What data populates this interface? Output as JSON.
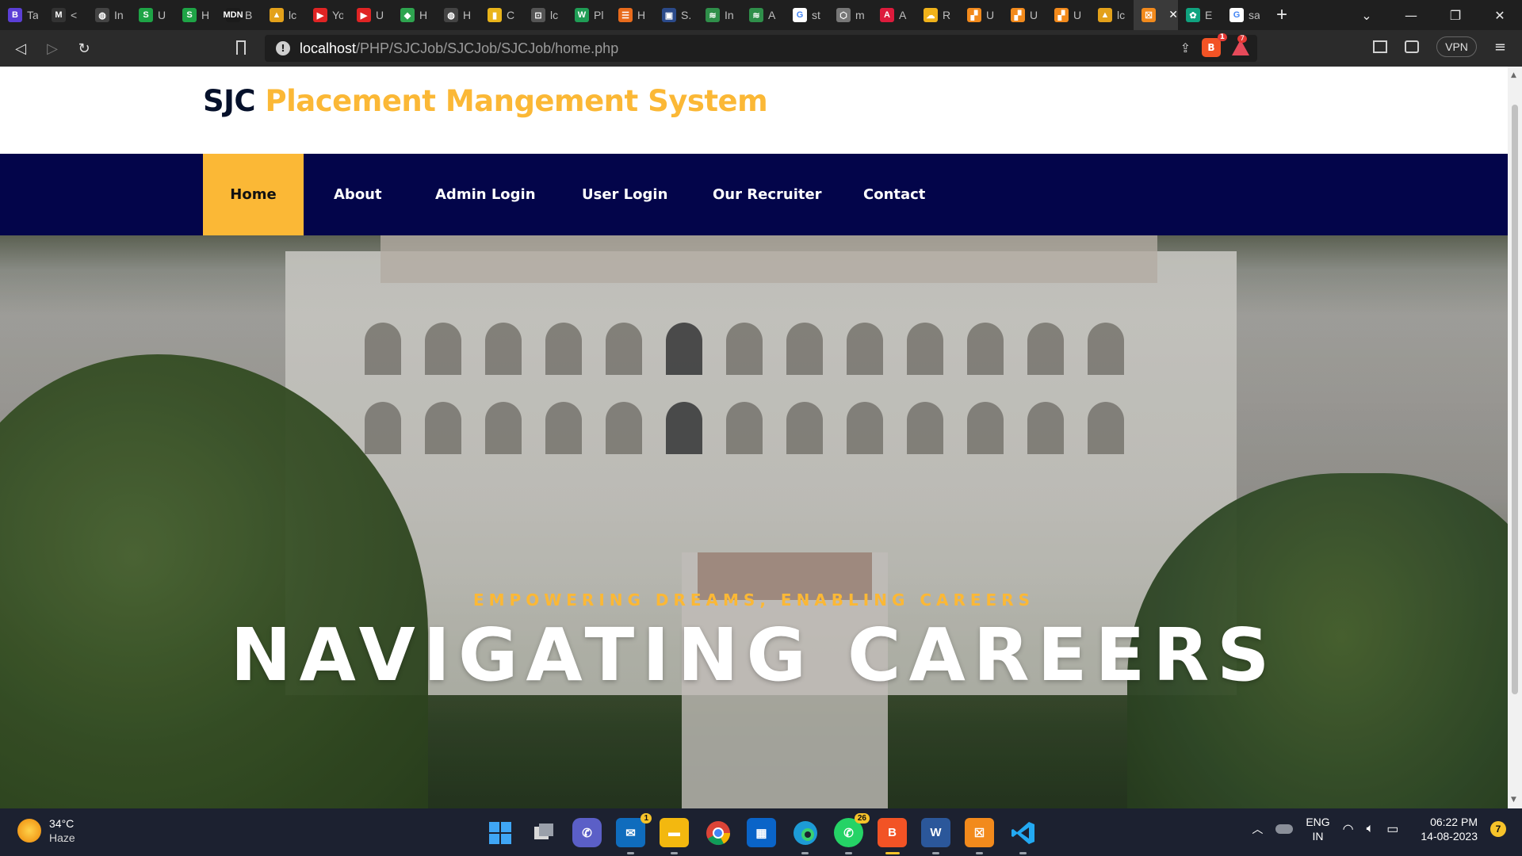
{
  "browser": {
    "tabs": [
      {
        "icon": "B",
        "title": "Ta",
        "color": "#5b3fd6"
      },
      {
        "icon": "M",
        "title": "<",
        "color": "#333333"
      },
      {
        "icon": "◍",
        "title": "In",
        "color": "#444444"
      },
      {
        "icon": "S",
        "title": "U",
        "color": "#1ea446"
      },
      {
        "icon": "S",
        "title": "H",
        "color": "#1ea446"
      },
      {
        "icon": "MDN",
        "title": "B",
        "color": "#1b1b1b"
      },
      {
        "icon": "▲",
        "title": "lc",
        "color": "#e3a11a"
      },
      {
        "icon": "▶",
        "title": "Yo",
        "color": "#e02424"
      },
      {
        "icon": "▶",
        "title": "U",
        "color": "#e02424"
      },
      {
        "icon": "◆",
        "title": "H",
        "color": "#2ea44f"
      },
      {
        "icon": "◍",
        "title": "H",
        "color": "#444444"
      },
      {
        "icon": "▮",
        "title": "C",
        "color": "#e9b41a"
      },
      {
        "icon": "⊡",
        "title": "lc",
        "color": "#555555"
      },
      {
        "icon": "W",
        "title": "Pl",
        "color": "#1f9d55"
      },
      {
        "icon": "☰",
        "title": "H",
        "color": "#e86b1c"
      },
      {
        "icon": "▣",
        "title": "S.",
        "color": "#2b4a8a"
      },
      {
        "icon": "≋",
        "title": "In",
        "color": "#2f8f4a"
      },
      {
        "icon": "≋",
        "title": "A",
        "color": "#2f8f4a"
      },
      {
        "icon": "G",
        "title": "st",
        "color": "#ffffff"
      },
      {
        "icon": "⬡",
        "title": "m",
        "color": "#777777"
      },
      {
        "icon": "A",
        "title": "A",
        "color": "#dd1b3c"
      },
      {
        "icon": "☁",
        "title": "R",
        "color": "#f0b21a"
      },
      {
        "icon": "▞",
        "title": "U",
        "color": "#f28a1c"
      },
      {
        "icon": "▞",
        "title": "U",
        "color": "#f28a1c"
      },
      {
        "icon": "▞",
        "title": "U",
        "color": "#f28a1c"
      },
      {
        "icon": "▲",
        "title": "lc",
        "color": "#e3a11a"
      },
      {
        "icon": "☒",
        "title": "",
        "color": "#f28a1c"
      },
      {
        "icon": "✿",
        "title": "E",
        "color": "#10a37f"
      },
      {
        "icon": "G",
        "title": "sa",
        "color": "#ffffff"
      }
    ],
    "new_tab": "+",
    "url_host": "localhost",
    "url_path": "/PHP/SJCJob/SJCJob/SJCJob/home.php",
    "brave_badge": "1",
    "rewards_badge": "7",
    "vpn_label": "VPN"
  },
  "site": {
    "brand_prefix": "SJC",
    "brand_suffix": "Placement Mangement System",
    "nav": [
      "Home",
      "About",
      "Admin Login",
      "User Login",
      "Our Recruiter",
      "Contact"
    ],
    "hero_tagline": "EMPOWERING DREAMS, ENABLING CAREERS",
    "hero_title": "NAVIGATING CAREERS"
  },
  "taskbar": {
    "temperature": "34°C",
    "weather": "Haze",
    "mail_badge": "1",
    "whatsapp_badge": "26",
    "lang_top": "ENG",
    "lang_bottom": "IN",
    "time": "06:22 PM",
    "date": "14-08-2023",
    "notification_count": "7"
  },
  "colors": {
    "brand_dark": "#06112b",
    "brand_accent": "#fbb836",
    "nav_bg": "#03054a"
  }
}
